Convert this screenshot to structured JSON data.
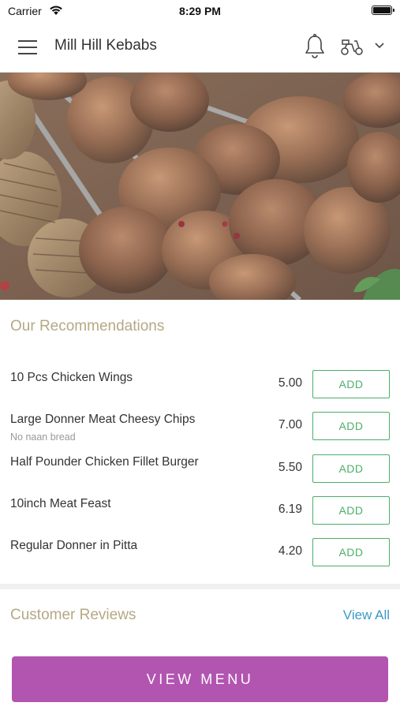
{
  "status_bar": {
    "carrier": "Carrier",
    "time": "8:29 PM"
  },
  "header": {
    "title": "Mill Hill Kebabs",
    "icons": [
      "menu-icon",
      "bell-icon",
      "scooter-icon",
      "chevron-down-icon"
    ]
  },
  "recommendations": {
    "title": "Our Recommendations",
    "items": [
      {
        "name": "10 Pcs Chicken Wings",
        "note": "",
        "price": "5.00",
        "action": "ADD"
      },
      {
        "name": "Large Donner Meat Cheesy Chips",
        "note": "No naan bread",
        "price": "7.00",
        "action": "ADD"
      },
      {
        "name": "Half Pounder Chicken Fillet Burger",
        "note": "",
        "price": "5.50",
        "action": "ADD"
      },
      {
        "name": "10inch Meat Feast",
        "note": "",
        "price": "6.19",
        "action": "ADD"
      },
      {
        "name": "Regular Donner in Pitta",
        "note": "",
        "price": "4.20",
        "action": "ADD"
      }
    ]
  },
  "reviews": {
    "title": "Customer Reviews",
    "view_all": "View All"
  },
  "cta": {
    "view_menu": "VIEW MENU"
  },
  "colors": {
    "accent_purple": "#b255b0",
    "add_green": "#4caf69",
    "section_title": "#b5a884",
    "link_blue": "#3a9ac9"
  }
}
